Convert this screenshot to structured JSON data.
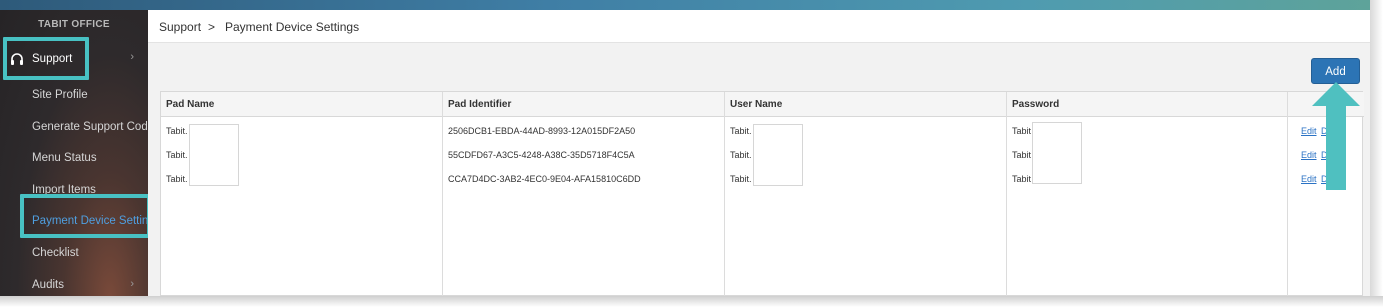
{
  "sidebar": {
    "brand": "TABIT OFFICE",
    "items": [
      {
        "label": "Support",
        "chevron": "›"
      },
      {
        "label": "Site Profile"
      },
      {
        "label": "Generate Support Code"
      },
      {
        "label": "Menu Status"
      },
      {
        "label": "Import Items"
      },
      {
        "label": "Payment Device Settings"
      },
      {
        "label": "Checklist"
      },
      {
        "label": "Audits",
        "chevron": "›"
      }
    ],
    "active_color": "#4f9fe0",
    "highlight_color": "#48c1c3"
  },
  "breadcrumb": {
    "root": "Support",
    "separator": ">",
    "current": "Payment Device Settings"
  },
  "toolbar": {
    "add_label": "Add",
    "add_color": "#2c74b5"
  },
  "table": {
    "headers": [
      "Pad Name",
      "Pad Identifier",
      "User Name",
      "Password",
      ""
    ],
    "rows": [
      {
        "pad_name": "Tabit.",
        "pad_identifier": "2506DCB1-EBDA-44AD-8993-12A015DF2A50",
        "user_name": "Tabit.",
        "password": "Tabit",
        "edit": "Edit",
        "delete": "D"
      },
      {
        "pad_name": "Tabit.",
        "pad_identifier": "55CDFD67-A3C5-4248-A38C-35D5718F4C5A",
        "user_name": "Tabit.",
        "password": "Tabit",
        "edit": "Edit",
        "delete": "D"
      },
      {
        "pad_name": "Tabit.",
        "pad_identifier": "CCA7D4DC-3AB2-4EC0-9E04-AFA15810C6DD",
        "user_name": "Tabit.",
        "password": "Tabit",
        "edit": "Edit",
        "delete": "D"
      }
    ]
  },
  "annotation": {
    "arrow_color": "#4fc0c0",
    "icon": "up-arrow-annotation"
  },
  "icons": {
    "support": "headphones-icon"
  }
}
